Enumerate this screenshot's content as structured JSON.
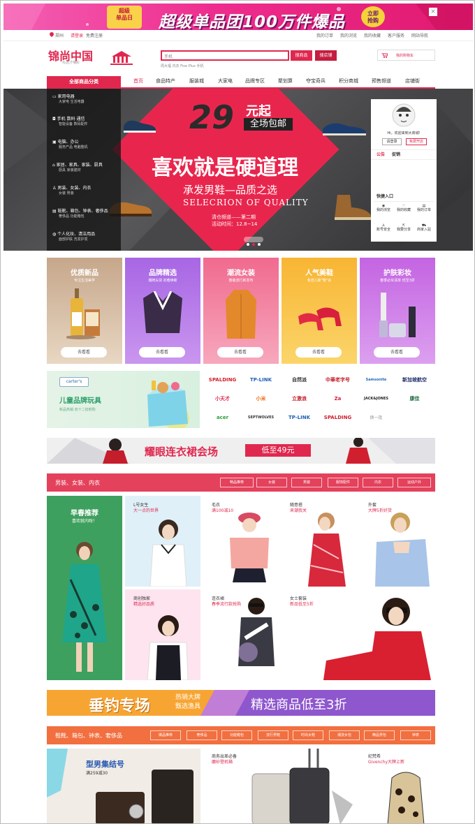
{
  "promo": {
    "badge": "超级\n单品日",
    "title": "超级单品团100万件爆品",
    "buy": "立即\n抢购",
    "close": "×"
  },
  "topbar": {
    "location": "郑州",
    "login": "请登录",
    "register": "免费注册",
    "links": [
      "我的订单",
      "我的浏览",
      "我的收藏",
      "客户服务",
      "网站导航"
    ]
  },
  "header": {
    "logo": "锦尚中国",
    "logo_sub": "先选才嘎彩",
    "search_value": "手机",
    "search_btn": "搜商品",
    "search_shop_btn": "搜店铺",
    "hot_keywords": "周大福   内衣   Five Plus   手机",
    "cart": "我的购物车"
  },
  "nav": {
    "all_categories": "全部商品分类",
    "items": [
      "首页",
      "食品特产",
      "服装城",
      "大家电",
      "品牌专区",
      "聚划算",
      "夺宝奇兵",
      "积分商城",
      "预售频道",
      "店铺街"
    ]
  },
  "categories": [
    {
      "title": "家用电器",
      "sub": "大家电  生活电器"
    },
    {
      "title": "手机  数码  通信",
      "sub": "智能设备  数码配件"
    },
    {
      "title": "电脑、办公",
      "sub": "服务产品  电脑整机"
    },
    {
      "title": "家居、家具、家装、厨具",
      "sub": "厨具  家装建材"
    },
    {
      "title": "男装、女装、内衣",
      "sub": "女装  男装"
    },
    {
      "title": "鞋靴、箱包、钟表、奢侈品",
      "sub": "奢侈品  功能箱包"
    },
    {
      "title": "个人化妆、清洁用品",
      "sub": "面部护肤  洗发护发"
    }
  ],
  "banner": {
    "price": "29",
    "price_suffix": "元起",
    "free_ship": "全场包邮",
    "headline": "喜欢就是硬道理",
    "sub_cn": "承发男鞋—品质之选",
    "sub_en": "SELECRION OF QUALITY",
    "event": "清仓频道——第二期",
    "date": "活动时间：12.8~14"
  },
  "userbox": {
    "greeting": "Hi，欢迎来到大商城!",
    "login": "请登录",
    "register": "免费开店",
    "tab_notice": "公告",
    "tab_promo": "促销",
    "quick_title": "快捷入口",
    "quick": [
      "我的浏览",
      "我的收藏",
      "我的订单",
      "账号安全",
      "我要分享",
      "商家入驻"
    ]
  },
  "cards": [
    {
      "title": "优质新品",
      "sub": "专注生活美学",
      "btn": "去看看",
      "color": "#c9a88a"
    },
    {
      "title": "品牌精选",
      "sub": "潮牌尖货 初春焕新",
      "btn": "去看看",
      "color": "#a769e0"
    },
    {
      "title": "潮流女装",
      "sub": "春装流行新发布",
      "btn": "去看看",
      "color": "#f26a8d"
    },
    {
      "title": "人气美鞋",
      "sub": "有范儿新\"鞋\"会",
      "btn": "去看看",
      "color": "#f6b93b"
    },
    {
      "title": "护肤彩妆",
      "sub": "春季必买清单 低至3折",
      "btn": "去看看",
      "color": "#c065e0"
    }
  ],
  "kids": {
    "brand": "carter's",
    "title": "儿童品牌玩具",
    "sub": "新品热销 双十二抢鲜购"
  },
  "brands": [
    "SPALDING",
    "TP-LINK",
    "自然派",
    "中華老字号",
    "Samsonite",
    "新加坡航空",
    "小天才",
    "小米",
    "立激浪",
    "Za",
    "JACK&JONES",
    "康佳",
    "acer",
    "SEPTWOLVES",
    "TP-LINK",
    "SPALDING"
  ],
  "brands_refresh": "换一批",
  "dress_banner": {
    "title": "耀眼连衣裙会场",
    "price": "低至49元"
  },
  "section1": {
    "title": "男装、女装、内衣",
    "tags": [
      "畅品推荐",
      "女装",
      "男装",
      "服饰配件",
      "内衣",
      "运动户外"
    ]
  },
  "fashion": {
    "feature_title": "早春推荐",
    "feature_sub": "喜欢就内呀！",
    "cells": [
      {
        "title": "L号女生",
        "sub": "大一点的世界"
      },
      {
        "title": "毛衣",
        "sub": "满100减10"
      },
      {
        "title": "随意搭",
        "sub": "来潮我关"
      },
      {
        "title": "外套",
        "sub": "大牌5折好货"
      },
      {
        "title": "商创独家",
        "sub": "精选好品质"
      },
      {
        "title": "连衣裙",
        "sub": "春季流行款抢购"
      },
      {
        "title": "女士套装",
        "sub": "新品低至5折"
      }
    ]
  },
  "fishing": {
    "title": "垂钓专场",
    "sub1": "热销大牌",
    "sub2": "甄选渔具",
    "right": "精选商品低至3折"
  },
  "section2": {
    "title": "鞋靴、箱包、钟表、奢侈品",
    "tags": [
      "爆品推荐",
      "奢侈品",
      "功能箱包",
      "流行男鞋",
      "时尚女鞋",
      "潮流女包",
      "精品男包",
      "钟表"
    ]
  },
  "bags": {
    "feature_title": "型男集结号",
    "feature_sub": "满259减30",
    "cells": [
      {
        "title": "商务出差必备",
        "sub": "磨砂登机箱"
      },
      {
        "title": "纪梵希",
        "sub": "Givenchy大牌上新"
      }
    ]
  }
}
